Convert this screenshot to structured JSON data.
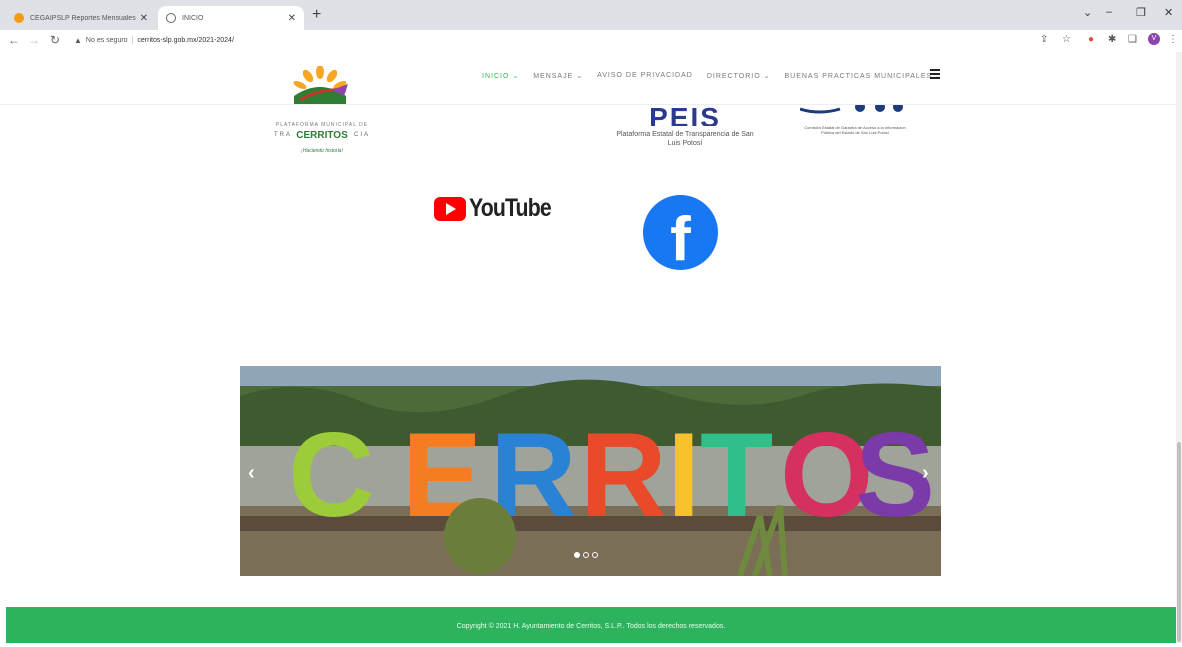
{
  "browser": {
    "tabs": [
      {
        "title": "CEGAIPSLP Reportes Mensuales",
        "favicon_color": "#f39c12"
      },
      {
        "title": "INICIO",
        "favicon_color": "#666666"
      }
    ],
    "new_tab": "+",
    "window_controls": [
      "⌄",
      "–",
      "❐",
      "✕"
    ],
    "security_label": "No es seguro",
    "url": "cerritos-slp.gob.mx/2021-2024/",
    "profile_initial": "V"
  },
  "site": {
    "nav": [
      {
        "label": "INICIO ⌄",
        "active": true
      },
      {
        "label": "MENSAJE ⌄",
        "active": false
      },
      {
        "label": "AVISO DE PRIVACIDAD",
        "active": false
      },
      {
        "label": "DIRECTORIO ⌄",
        "active": false
      },
      {
        "label": "BUENAS PRACTICAS MUNICIPALES ⌄",
        "active": false
      }
    ],
    "logos": {
      "cerritos_top": "PLATAFORMA MUNICIPAL DE",
      "cerritos_name": "CERRITOS",
      "cerritos_trans_left": "TRA",
      "cerritos_trans_right": "CIA",
      "cerritos_slogan": "¡Haciendo historia!",
      "peis_title": "PEIS",
      "peis_subtitle": "Plataforma Estatal de Transparencia de San Luis Potosí",
      "cegaip_sub": "Comisión Estatal de Garantía de Acceso a la Información Pública del Estado de San Luis Potosí"
    },
    "social": {
      "youtube": "YouTube",
      "facebook": "f"
    },
    "slider": {
      "letters": [
        "C",
        "E",
        "R",
        "R",
        "I",
        "T",
        "O",
        "S"
      ],
      "prev": "‹",
      "next": "›",
      "slides": 3,
      "current": 1
    },
    "footer": "Copyright © 2021 H. Ayuntamiento de Cerritos, S.L.P.. Todos los derechos reservados."
  }
}
